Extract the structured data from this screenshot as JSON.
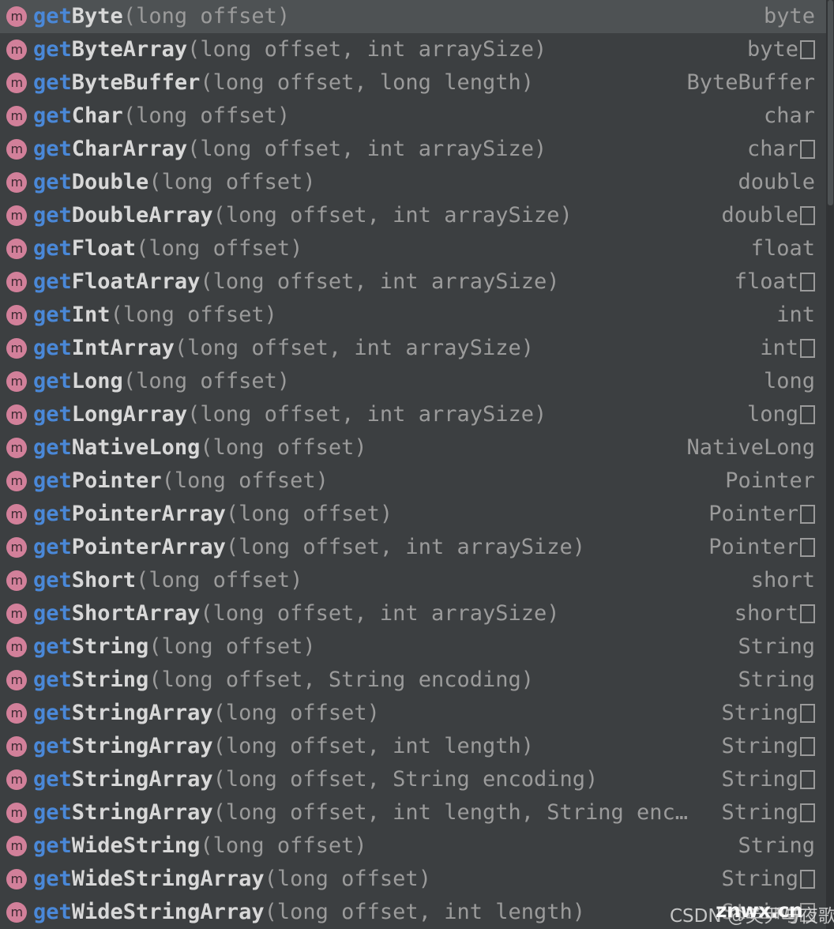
{
  "popup": {
    "kind": "code-completion-popup",
    "colors": {
      "background": "#3c3f41",
      "selected_row": "#4e5254",
      "prefix_match": "#4a88d8",
      "method_name": "#d8d8d8",
      "parameters": "#9b9b9b",
      "return_type": "#9b9b9b",
      "icon_fill": "#d2809a",
      "scrollbar_track": "#313335",
      "scrollbar_thumb": "#4e5254"
    },
    "icon_label": "m",
    "icon_name": "method-icon"
  },
  "items": [
    {
      "icon": "method-icon",
      "prefix": "get",
      "name": "Byte",
      "params": "(long offset)",
      "ret": "byte",
      "array": false,
      "selected": true
    },
    {
      "icon": "method-icon",
      "prefix": "get",
      "name": "ByteArray",
      "params": "(long offset, int arraySize)",
      "ret": "byte",
      "array": true,
      "selected": false
    },
    {
      "icon": "method-icon",
      "prefix": "get",
      "name": "ByteBuffer",
      "params": "(long offset, long length)",
      "ret": "ByteBuffer",
      "array": false,
      "selected": false
    },
    {
      "icon": "method-icon",
      "prefix": "get",
      "name": "Char",
      "params": "(long offset)",
      "ret": "char",
      "array": false,
      "selected": false
    },
    {
      "icon": "method-icon",
      "prefix": "get",
      "name": "CharArray",
      "params": "(long offset, int arraySize)",
      "ret": "char",
      "array": true,
      "selected": false
    },
    {
      "icon": "method-icon",
      "prefix": "get",
      "name": "Double",
      "params": "(long offset)",
      "ret": "double",
      "array": false,
      "selected": false
    },
    {
      "icon": "method-icon",
      "prefix": "get",
      "name": "DoubleArray",
      "params": "(long offset, int arraySize)",
      "ret": "double",
      "array": true,
      "selected": false
    },
    {
      "icon": "method-icon",
      "prefix": "get",
      "name": "Float",
      "params": "(long offset)",
      "ret": "float",
      "array": false,
      "selected": false
    },
    {
      "icon": "method-icon",
      "prefix": "get",
      "name": "FloatArray",
      "params": "(long offset, int arraySize)",
      "ret": "float",
      "array": true,
      "selected": false
    },
    {
      "icon": "method-icon",
      "prefix": "get",
      "name": "Int",
      "params": "(long offset)",
      "ret": "int",
      "array": false,
      "selected": false
    },
    {
      "icon": "method-icon",
      "prefix": "get",
      "name": "IntArray",
      "params": "(long offset, int arraySize)",
      "ret": "int",
      "array": true,
      "selected": false
    },
    {
      "icon": "method-icon",
      "prefix": "get",
      "name": "Long",
      "params": "(long offset)",
      "ret": "long",
      "array": false,
      "selected": false
    },
    {
      "icon": "method-icon",
      "prefix": "get",
      "name": "LongArray",
      "params": "(long offset, int arraySize)",
      "ret": "long",
      "array": true,
      "selected": false
    },
    {
      "icon": "method-icon",
      "prefix": "get",
      "name": "NativeLong",
      "params": "(long offset)",
      "ret": "NativeLong",
      "array": false,
      "selected": false
    },
    {
      "icon": "method-icon",
      "prefix": "get",
      "name": "Pointer",
      "params": "(long offset)",
      "ret": "Pointer",
      "array": false,
      "selected": false
    },
    {
      "icon": "method-icon",
      "prefix": "get",
      "name": "PointerArray",
      "params": "(long offset)",
      "ret": "Pointer",
      "array": true,
      "selected": false
    },
    {
      "icon": "method-icon",
      "prefix": "get",
      "name": "PointerArray",
      "params": "(long offset, int arraySize)",
      "ret": "Pointer",
      "array": true,
      "selected": false
    },
    {
      "icon": "method-icon",
      "prefix": "get",
      "name": "Short",
      "params": "(long offset)",
      "ret": "short",
      "array": false,
      "selected": false
    },
    {
      "icon": "method-icon",
      "prefix": "get",
      "name": "ShortArray",
      "params": "(long offset, int arraySize)",
      "ret": "short",
      "array": true,
      "selected": false
    },
    {
      "icon": "method-icon",
      "prefix": "get",
      "name": "String",
      "params": "(long offset)",
      "ret": "String",
      "array": false,
      "selected": false
    },
    {
      "icon": "method-icon",
      "prefix": "get",
      "name": "String",
      "params": "(long offset, String encoding)",
      "ret": "String",
      "array": false,
      "selected": false
    },
    {
      "icon": "method-icon",
      "prefix": "get",
      "name": "StringArray",
      "params": "(long offset)",
      "ret": "String",
      "array": true,
      "selected": false
    },
    {
      "icon": "method-icon",
      "prefix": "get",
      "name": "StringArray",
      "params": "(long offset, int length)",
      "ret": "String",
      "array": true,
      "selected": false
    },
    {
      "icon": "method-icon",
      "prefix": "get",
      "name": "StringArray",
      "params": "(long offset, String encoding)",
      "ret": "String",
      "array": true,
      "selected": false
    },
    {
      "icon": "method-icon",
      "prefix": "get",
      "name": "StringArray",
      "params": "(long offset, int length, String enc…",
      "ret": "String",
      "array": true,
      "selected": false
    },
    {
      "icon": "method-icon",
      "prefix": "get",
      "name": "WideString",
      "params": "(long offset)",
      "ret": "String",
      "array": false,
      "selected": false
    },
    {
      "icon": "method-icon",
      "prefix": "get",
      "name": "WideStringArray",
      "params": "(long offset)",
      "ret": "String",
      "array": true,
      "selected": false
    },
    {
      "icon": "method-icon",
      "prefix": "get",
      "name": "WideStringArray",
      "params": "(long offset, int length)",
      "ret": "String",
      "array": true,
      "selected": false
    }
  ],
  "watermarks": {
    "csdn": "CSDN @英尹与夜歌",
    "site": "znwx.cn"
  }
}
